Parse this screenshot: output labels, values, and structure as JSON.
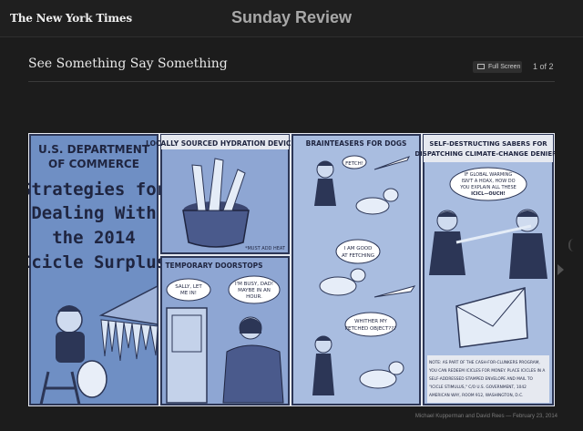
{
  "header": {
    "logo": "The New York Times",
    "section": "Sunday Review"
  },
  "slideshow": {
    "title": "See Something Say Something",
    "fullscreen_label": "Full Screen",
    "pager": "1 of 2"
  },
  "comic": {
    "title_panel": {
      "line1": "U.S. DEPARTMENT",
      "line2": "OF COMMERCE",
      "headline": [
        "Strategies for",
        "Dealing With",
        "the 2014",
        "Icicle Surplus"
      ]
    },
    "panel_hydration": {
      "caption": "LOCALLY SOURCED HYDRATION DEVICES*",
      "footnote": "*MUST ADD HEAT"
    },
    "panel_doorstops": {
      "caption": "TEMPORARY DOORSTOPS",
      "bubble_left": [
        "SALLY, LET",
        "ME IN!"
      ],
      "bubble_right": [
        "I'M BUSY, DAD!",
        "MAYBE IN AN",
        "HOUR."
      ]
    },
    "panel_dogs": {
      "caption": "BRAINTEASERS FOR DOGS",
      "bubble1": "FETCH!",
      "bubble2": [
        "I AM GOOD",
        "AT FETCHING"
      ],
      "bubble3": [
        "WHITHER MY",
        "FETCHED OBJECT???"
      ]
    },
    "panel_sabers": {
      "caption": [
        "SELF-DESTRUCTING SABERS FOR",
        "DISPATCHING CLIMATE-CHANGE DENIERS"
      ],
      "bubble": [
        "IF GLOBAL WARMING",
        "ISN'T A HOAX, HOW DO",
        "YOU EXPLAIN ALL THESE",
        "ICICL—OUCH!"
      ],
      "note": [
        "NOTE: AS PART OF THE CASH-FOR-CLUNKERS PROGRAM,",
        "YOU CAN REDEEM ICICLES FOR MONEY. PLACE ICICLES IN A",
        "SELF-ADDRESSED STAMPED ENVELOPE AND MAIL TO",
        "\"ICICLE STIMULUS,\" C/O U.S. GOVERNMENT, 1042",
        "AMERICAN WAY, ROOM 912, WASHINGTON, D.C."
      ]
    }
  },
  "credit": "Michael Kupperman and David Rees — February 23, 2014",
  "colors": {
    "page_bg": "#1c1c1c",
    "comic_blue": "#6f8fc4",
    "comic_dark": "#2c3656",
    "comic_light": "#dbe4f2"
  }
}
